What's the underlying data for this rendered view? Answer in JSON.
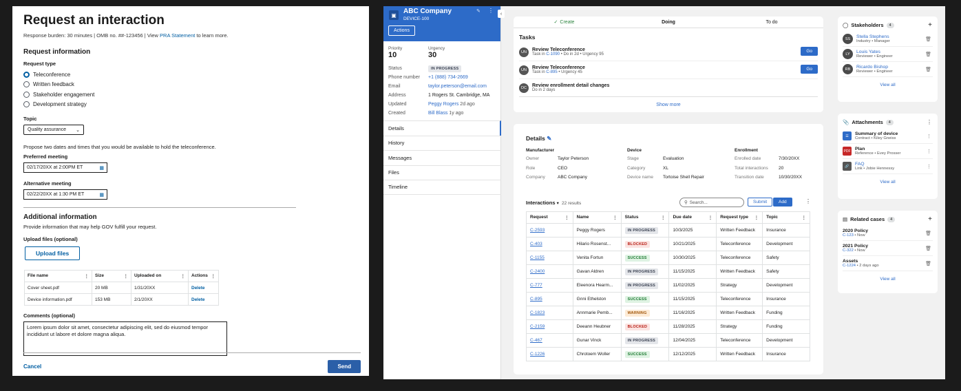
{
  "form": {
    "title": "Request an interaction",
    "burden_text": "Response burden: 30 minutes | OMB no. ##-123456 | View ",
    "burden_link": "PRA Statement",
    "burden_suffix": " to learn more.",
    "request_info_title": "Request information",
    "request_type_label": "Request type",
    "request_types": [
      "Teleconference",
      "Written feedback",
      "Stakeholder engagement",
      "Development strategy"
    ],
    "topic_label": "Topic",
    "topic_value": "Quality assurance",
    "propose_hint": "Propose two dates and times that you would be available to hold the teleconference.",
    "preferred_label": "Preferred meeting",
    "preferred_value": "02/17/20XX at 2:00PM ET",
    "alternative_label": "Alternative meeting",
    "alternative_value": "02/22/20XX at 1:30 PM ET",
    "additional_title": "Additional information",
    "additional_hint": "Provide information that may help GOV fulfill your request.",
    "upload_label": "Upload files (optional)",
    "upload_button": "Upload files",
    "file_headers": [
      "File name",
      "Size",
      "Uploaded on",
      "Actions"
    ],
    "files": [
      {
        "name": "Cover sheet.pdf",
        "size": "20 MB",
        "uploaded": "1/31/20XX",
        "action": "Delete"
      },
      {
        "name": "Device information.pdf",
        "size": "153 MB",
        "uploaded": "2/1/20XX",
        "action": "Delete"
      }
    ],
    "comments_label": "Comments (optional)",
    "comments_value": "Lorem ipsum dolor sit amet, consectetur adipiscing elit, sed do eiusmod tempor incididunt ut labore et dolore magna aliqua.",
    "cancel": "Cancel",
    "send": "Send"
  },
  "sidebar": {
    "company": "ABC Company",
    "device": "DEVICE-100",
    "actions": "Actions",
    "priority_label": "Priority",
    "priority": "10",
    "urgency_label": "Urgency",
    "urgency": "30",
    "fields": [
      {
        "k": "Status",
        "v": "IN PROGRESS"
      },
      {
        "k": "Phone number",
        "v": "+1 (888) 734-2669"
      },
      {
        "k": "Email",
        "v": "taylor.peterson@email.com"
      },
      {
        "k": "Address",
        "v": "1 Rogers St. Cambridge, MA"
      },
      {
        "k": "Updated",
        "v": "Peggy Rogers",
        "v2": " 2d ago"
      },
      {
        "k": "Created",
        "v": "Bill Blass",
        "v2": " 1y ago"
      }
    ],
    "nav": [
      "Details",
      "History",
      "Messages",
      "Files",
      "Timeline"
    ]
  },
  "stepper": {
    "create": "Create",
    "doing": "Doing",
    "todo": "To do"
  },
  "tasks": {
    "title": "Tasks",
    "items": [
      {
        "initials": "UN",
        "title": "Review Teleconference",
        "pre": "Task in ",
        "link": "C-1090",
        "post": " • Do in 2d • Urgency 95",
        "go": "Go"
      },
      {
        "initials": "UN",
        "title": "Review Teleconference",
        "pre": "Task in ",
        "link": "C-895",
        "post": " • Urgency 45",
        "go": "Go"
      },
      {
        "initials": "DC",
        "title": "Review enrollment detail changes",
        "pre": "Do in 2 days",
        "link": "",
        "post": "",
        "go": ""
      }
    ],
    "show_more": "Show more"
  },
  "details": {
    "title": "Details",
    "manufacturer": {
      "heading": "Manufacturer",
      "rows": [
        [
          "Owner",
          "Taylor Peterson"
        ],
        [
          "Role",
          "CEO"
        ],
        [
          "Company",
          "ABC Company"
        ]
      ]
    },
    "device": {
      "heading": "Device",
      "rows": [
        [
          "Stage",
          "Evaluation"
        ],
        [
          "Category",
          "XL"
        ],
        [
          "Device name",
          "Tortoise Shell Repair"
        ]
      ]
    },
    "enrollment": {
      "heading": "Enrollment",
      "rows": [
        [
          "Enrolled date",
          "7/30/20XX"
        ],
        [
          "Total interactions",
          "20"
        ],
        [
          "Transition date",
          "10/30/20XX"
        ]
      ]
    }
  },
  "interactions": {
    "title": "Interactions",
    "count": "22 results",
    "search_placeholder": "Search...",
    "submit": "Submit",
    "add": "Add",
    "headers": [
      "Request",
      "Name",
      "Status",
      "Due date",
      "Request type",
      "Topic"
    ],
    "rows": [
      [
        "C-2593",
        "Peggy Rogers",
        "IN PROGRESS",
        "10/3/2025",
        "Written Feedback",
        "Insurance"
      ],
      [
        "C-403",
        "Hilario Rosenst...",
        "BLOCKED",
        "10/21/2025",
        "Teleconference",
        "Development"
      ],
      [
        "C-1155",
        "Venita Fortun",
        "SUCCESS",
        "10/30/2025",
        "Teleconference",
        "Safety"
      ],
      [
        "C-2400",
        "Gavan Aldren",
        "IN PROGRESS",
        "11/15/2025",
        "Written Feedback",
        "Safety"
      ],
      [
        "C-777",
        "Eleenora Hearm...",
        "IN PROGRESS",
        "11/02/2025",
        "Strategy",
        "Development"
      ],
      [
        "C-895",
        "Gnni Ethelston",
        "SUCCESS",
        "11/15/2025",
        "Teleconference",
        "Insurance"
      ],
      [
        "C-1823",
        "Annmarie Pemb...",
        "WARNING",
        "11/16/2025",
        "Written Feedback",
        "Funding"
      ],
      [
        "C-2159",
        "Deeann Heubner",
        "BLOCKED",
        "11/28/2025",
        "Strategy",
        "Funding"
      ],
      [
        "C-467",
        "Gunar Vinck",
        "IN PROGRESS",
        "12/04/2025",
        "Teleconference",
        "Development"
      ],
      [
        "C-1226",
        "Chrotoem Woller",
        "SUCCESS",
        "12/12/2025",
        "Written Feedback",
        "Insurance"
      ]
    ]
  },
  "stakeholders": {
    "title": "Stakeholders",
    "count": "4",
    "items": [
      {
        "initials": "SS",
        "name": "Stella Stephens",
        "sub": "Industry • Manager"
      },
      {
        "initials": "LY",
        "name": "Louis Yates",
        "sub": "Reviewer • Engineer"
      },
      {
        "initials": "RB",
        "name": "Ricardo Bishop",
        "sub": "Reviewer • Engineer"
      }
    ],
    "view_all": "View all"
  },
  "attachments": {
    "title": "Attachments",
    "count": "4",
    "items": [
      {
        "name": "Summary of device",
        "sub": "Contract • Kiley Gneiss"
      },
      {
        "name": "Plan",
        "sub": "Reference • Evey Prosser",
        "icon_text": "PDF"
      },
      {
        "name": "FAQ",
        "sub": "Link • Jobie Hennessy"
      }
    ],
    "view_all": "View all"
  },
  "related": {
    "title": "Related cases",
    "count": "4",
    "items": [
      {
        "name": "2020 Policy",
        "link": "C-123",
        "sub": " • Now"
      },
      {
        "name": "2021 Policy",
        "link": "C-322",
        "sub": " • Now"
      },
      {
        "name": "Assets",
        "link": "C-1224",
        "sub": " • 2 days ago"
      }
    ],
    "view_all": "View all"
  },
  "colors": {
    "primary": "#2d6bc8",
    "uswds_blue": "#005ea2"
  }
}
